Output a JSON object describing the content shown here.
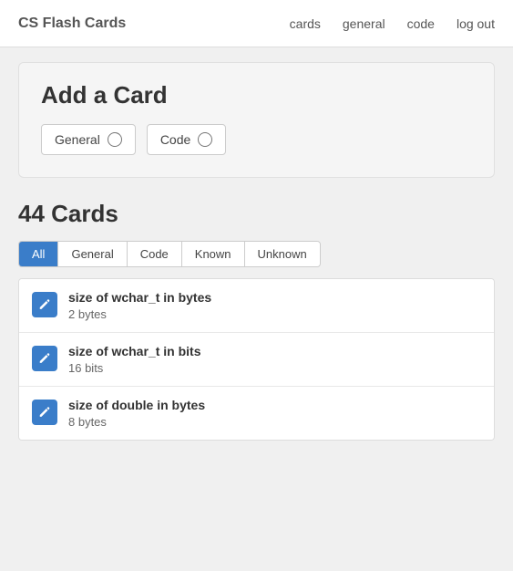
{
  "navbar": {
    "brand": "CS Flash Cards",
    "links": [
      "cards",
      "general",
      "code",
      "log out"
    ]
  },
  "addCard": {
    "title": "Add a Card",
    "options": [
      "General",
      "Code"
    ]
  },
  "cardsCount": "44 Cards",
  "filterTabs": [
    "All",
    "General",
    "Code",
    "Known",
    "Unknown"
  ],
  "activeTab": "All",
  "cards": [
    {
      "question": "size of wchar_t in bytes",
      "answer": "2 bytes"
    },
    {
      "question": "size of wchar_t in bits",
      "answer": "16 bits"
    },
    {
      "question": "size of double in bytes",
      "answer": "8 bytes"
    }
  ]
}
